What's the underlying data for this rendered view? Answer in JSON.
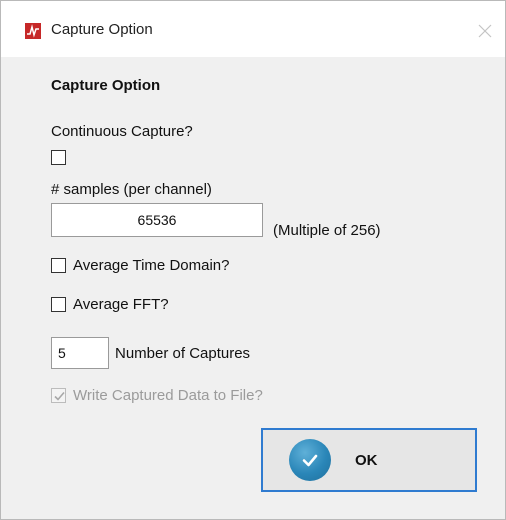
{
  "window": {
    "title": "Capture Option",
    "close_glyph": "✕",
    "icons": {
      "app": "waveform-app-icon",
      "close": "close-icon"
    },
    "accent_color": "#2f7bd0"
  },
  "form": {
    "heading": "Capture Option",
    "continuous_capture": {
      "label": "Continuous Capture?",
      "checked": false
    },
    "samples": {
      "label": "# samples (per channel)",
      "value": "65536",
      "hint": "(Multiple of 256)"
    },
    "average_time_domain": {
      "label": "Average Time Domain?",
      "checked": false
    },
    "average_fft": {
      "label": "Average FFT?",
      "checked": false
    },
    "captures": {
      "value": "5",
      "label": "Number of Captures"
    },
    "write_to_file": {
      "label": "Write Captured Data to File?",
      "checked": true,
      "enabled": false
    }
  },
  "ok_button": {
    "label": "OK",
    "icon": "checkmark-icon"
  }
}
